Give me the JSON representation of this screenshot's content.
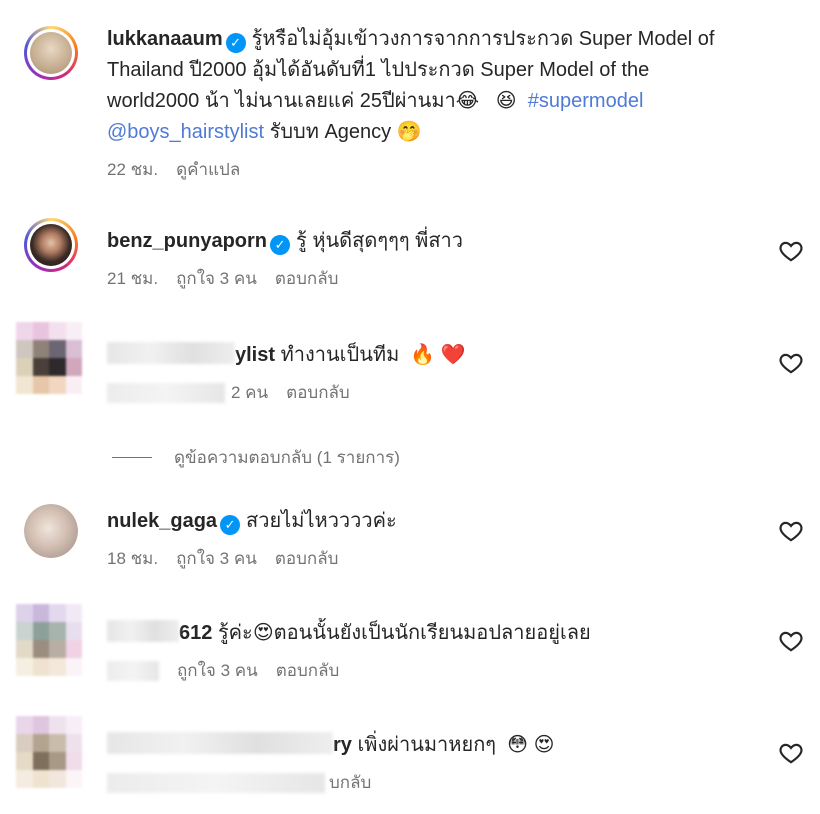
{
  "post": {
    "username": "lukkanaaum",
    "caption_part1": "รู้หรือไม่อุ้มเข้าวงการจากการประกวด Super Model of",
    "caption_part2": "Thailand ปี2000 อุ้มได้อันดับที่1 ไปประกวด Super Model of the",
    "caption_part3": "world2000 น้า ไม่นานเลยแค่ 25ปีผ่านมา",
    "emoji_1": "😂",
    "emoji_2": "😆",
    "hashtag": "#supermodel",
    "mention": "@boys_hairstylist",
    "caption_part4": "รับบท Agency",
    "emoji_3": "🤭",
    "time": "22 ชม.",
    "translate": "ดูคำแปล"
  },
  "comments": [
    {
      "username": "benz_punyaporn",
      "text": "รู้ หุ่นดีสุดๆๆๆ พี่สาว",
      "time": "21 ชม.",
      "likes": "ถูกใจ 3 คน",
      "reply": "ตอบกลับ"
    },
    {
      "username_visible": "ylist",
      "text": "ทำงานเป็นทีม",
      "emoji_1": "🔥",
      "emoji_2": "❤️",
      "likes_visible": "2 คน",
      "reply": "ตอบกลับ"
    },
    {
      "username": "nulek_gaga",
      "text": "สวยไม่ไหววววค่ะ",
      "time": "18 ชม.",
      "likes": "ถูกใจ 3 คน",
      "reply": "ตอบกลับ"
    },
    {
      "username_visible": "612",
      "text_1": "รู้ค่ะ",
      "emoji_1": "😍",
      "text_2": "ตอนนั้นยังเป็นนักเรียนมอปลายอยู่เลย",
      "likes": "ถูกใจ 3 คน",
      "reply": "ตอบกลับ"
    },
    {
      "username_visible": "ry",
      "text": "เพิ่งผ่านมาหยกๆ",
      "emoji_1": "😳",
      "emoji_2": "😍",
      "reply_visible": "บกลับ"
    }
  ],
  "view_replies": "ดูข้อความตอบกลับ (1 รายการ)",
  "icons": {
    "verified": "verified-badge-icon",
    "like": "heart-outline-icon"
  },
  "colors": {
    "accent_link": "#4f7bd6",
    "verified": "#0095f6",
    "meta_text": "#737373"
  }
}
